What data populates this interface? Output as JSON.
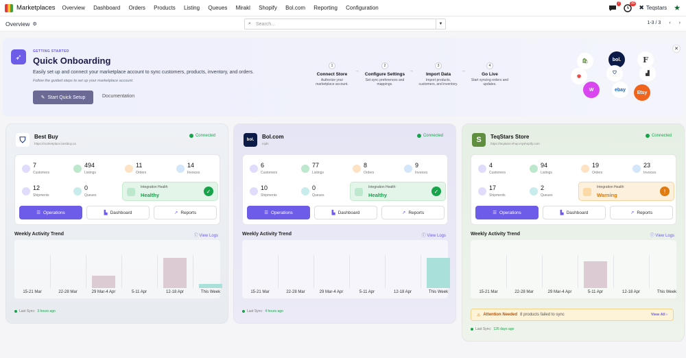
{
  "nav": {
    "app": "Marketplaces",
    "menu": [
      "Overview",
      "Dashboard",
      "Orders",
      "Products",
      "Listing",
      "Queues",
      "Mirakl",
      "Shopify",
      "Bol.com",
      "Reporting",
      "Configuration"
    ],
    "chat_badge": "7",
    "activity_badge": "30",
    "company": "Teqstars"
  },
  "sub": {
    "title": "Overview",
    "search_placeholder": "Search...",
    "pager": "1-3 / 3"
  },
  "onboarding": {
    "eyebrow": "GETTING STARTED",
    "title": "Quick Onboarding",
    "desc": "Easily set up and connect your marketplace account to sync customers, products, inventory, and orders.",
    "hint": "Follow the guided steps to set up your marketplace account.",
    "start_btn": "Start Quick Setup",
    "doc_link": "Documentation",
    "steps": [
      {
        "n": "1",
        "title": "Connect Store",
        "desc": "Authorize your marketplace account."
      },
      {
        "n": "2",
        "title": "Configure Settings",
        "desc": "Set sync preferences and mappings."
      },
      {
        "n": "3",
        "title": "Import Data",
        "desc": "Import products, customers, and inventory."
      },
      {
        "n": "4",
        "title": "Go Live",
        "desc": "Start syncing orders and updates."
      }
    ],
    "logos": {
      "bol": "bol.",
      "ebay": "ebay",
      "etsy": "Etsy",
      "f": "F",
      "w": "W"
    }
  },
  "cards": [
    {
      "name": "Best Buy",
      "url": "https://marketplace.bestbuy.ca",
      "status": "Connected",
      "stats": [
        {
          "v": "7",
          "l": "Customers"
        },
        {
          "v": "494",
          "l": "Listings"
        },
        {
          "v": "11",
          "l": "Orders"
        },
        {
          "v": "14",
          "l": "Invoices"
        },
        {
          "v": "12",
          "l": "Shipments"
        },
        {
          "v": "0",
          "l": "Queues"
        }
      ],
      "health_label": "Integration Health",
      "health": "Healthy",
      "buttons": [
        "Operations",
        "Dashboard",
        "Reports"
      ],
      "trend_title": "Weekly Activity Trend",
      "view_logs": "View Logs",
      "weeks": [
        "15-21 Mar",
        "22-28 Mar",
        "29 Mar-4 Apr",
        "5-11 Apr",
        "12-18 Apr",
        "This Week"
      ],
      "levels": [
        0,
        0,
        0.4,
        0,
        0.95,
        0.12
      ],
      "last_sync_label": "Last Sync:",
      "last_sync": "3 hours ago"
    },
    {
      "name": "Bol.com",
      "url": "mjds",
      "status": "Connected",
      "stats": [
        {
          "v": "6",
          "l": "Customers"
        },
        {
          "v": "77",
          "l": "Listings"
        },
        {
          "v": "8",
          "l": "Orders"
        },
        {
          "v": "9",
          "l": "Invoices"
        },
        {
          "v": "10",
          "l": "Shipments"
        },
        {
          "v": "0",
          "l": "Queues"
        }
      ],
      "health_label": "Integration Health",
      "health": "Healthy",
      "buttons": [
        "Operations",
        "Dashboard",
        "Reports"
      ],
      "trend_title": "Weekly Activity Trend",
      "view_logs": "View Logs",
      "weeks": [
        "15-21 Mar",
        "22-28 Mar",
        "29 Mar-4 Apr",
        "5-11 Apr",
        "12-18 Apr",
        "This Week"
      ],
      "levels": [
        0,
        0,
        0,
        0,
        0,
        0.95
      ],
      "last_sync_label": "Last Sync:",
      "last_sync": "4 hours ago"
    },
    {
      "name": "TeqStars Store",
      "url": "https://teqstars-shop.myshopify.com",
      "status": "Connected",
      "stats": [
        {
          "v": "4",
          "l": "Customers"
        },
        {
          "v": "94",
          "l": "Listings"
        },
        {
          "v": "19",
          "l": "Orders"
        },
        {
          "v": "23",
          "l": "Invoices"
        },
        {
          "v": "17",
          "l": "Shipments"
        },
        {
          "v": "2",
          "l": "Queues"
        }
      ],
      "health_label": "Integration Health",
      "health": "Warning",
      "buttons": [
        "Operations",
        "Dashboard",
        "Reports"
      ],
      "trend_title": "Weekly Activity Trend",
      "view_logs": "View Logs",
      "weeks": [
        "15-21 Mar",
        "22-28 Mar",
        "29 Mar-4 Apr",
        "5-11 Apr",
        "12-18 Apr",
        "This Week"
      ],
      "levels": [
        0,
        0,
        0,
        0.85,
        0,
        0
      ],
      "attention": "Attention Needed",
      "attention_msg": "8 products failed to sync",
      "view_all": "View All",
      "last_sync_label": "Last Sync:",
      "last_sync": "126 days ago"
    }
  ],
  "colors": {
    "accent": "#6c5ce7",
    "healthy": "#16a34a",
    "warning": "#f59e0b",
    "bar_pink": "#dccbd3",
    "bar_teal": "#a9e0d9"
  }
}
